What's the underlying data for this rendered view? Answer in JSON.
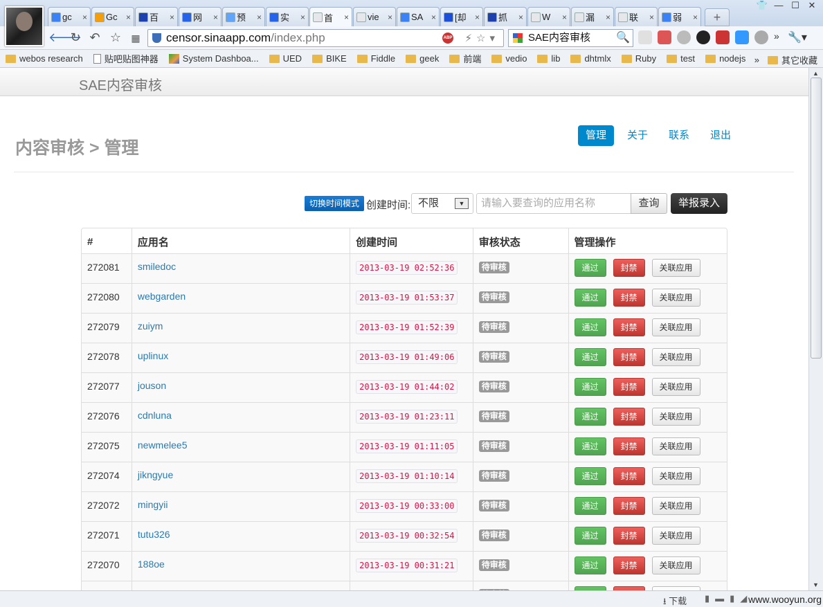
{
  "browser": {
    "tabs": [
      {
        "title": "gc",
        "fav": "#3b82f6",
        "active": false
      },
      {
        "title": "Gc",
        "fav": "#f59e0b",
        "active": false
      },
      {
        "title": "百",
        "fav": "#1e40af",
        "active": false
      },
      {
        "title": "网",
        "fav": "#2563eb",
        "active": false
      },
      {
        "title": "预",
        "fav": "#60a5fa",
        "active": false
      },
      {
        "title": "实",
        "fav": "#2563eb",
        "active": false
      },
      {
        "title": "首",
        "fav": "#e5e7eb",
        "active": true
      },
      {
        "title": "vie",
        "fav": "#e5e7eb",
        "active": false
      },
      {
        "title": "SA",
        "fav": "#3b82f6",
        "active": false
      },
      {
        "title": "[却",
        "fav": "#1d4ed8",
        "active": false
      },
      {
        "title": "抓",
        "fav": "#1e40af",
        "active": false
      },
      {
        "title": "W",
        "fav": "#e5e7eb",
        "active": false
      },
      {
        "title": "漏",
        "fav": "#e5e7eb",
        "active": false
      },
      {
        "title": "联",
        "fav": "#e5e7eb",
        "active": false
      },
      {
        "title": "弱",
        "fav": "#3b82f6",
        "active": false
      }
    ],
    "tab_close": "×",
    "new_tab": "+",
    "url_host": "censor.sinaapp.com",
    "url_path": "/index.php",
    "search_text": "SAE内容审核",
    "abp_label": "ABP",
    "bookmarks": [
      {
        "label": "webos research",
        "icon": "folder"
      },
      {
        "label": "贴吧贴图神器",
        "icon": "page"
      },
      {
        "label": "System Dashboa...",
        "icon": "dash"
      },
      {
        "label": "UED",
        "icon": "folder"
      },
      {
        "label": "BIKE",
        "icon": "folder"
      },
      {
        "label": "Fiddle",
        "icon": "folder"
      },
      {
        "label": "geek",
        "icon": "folder"
      },
      {
        "label": "前端",
        "icon": "folder"
      },
      {
        "label": "vedio",
        "icon": "folder"
      },
      {
        "label": "lib",
        "icon": "folder"
      },
      {
        "label": "dhtmlx",
        "icon": "folder"
      },
      {
        "label": "Ruby",
        "icon": "folder"
      },
      {
        "label": "test",
        "icon": "folder"
      },
      {
        "label": "nodejs",
        "icon": "folder"
      }
    ],
    "bookmarks_more": "»",
    "other_bookmarks": "其它收藏",
    "status_download": "下载",
    "watermark": "www.wooyun.org"
  },
  "page": {
    "brand": "SAE内容审核",
    "breadcrumb": "内容审核 > 管理",
    "nav": [
      {
        "label": "管理",
        "active": true
      },
      {
        "label": "关于",
        "active": false
      },
      {
        "label": "联系",
        "active": false
      },
      {
        "label": "退出",
        "active": false
      }
    ],
    "filter": {
      "mode_button": "切换时间模式",
      "created_label": "创建时间:",
      "select_value": "不限",
      "query_placeholder": "请输入要查询的应用名称",
      "query_button": "查询",
      "report_button": "举报录入"
    },
    "table": {
      "headers": [
        "#",
        "应用名",
        "创建时间",
        "审核状态",
        "管理操作"
      ],
      "actions": {
        "pass": "通过",
        "ban": "封禁",
        "related": "关联应用"
      },
      "status": "待审核",
      "rows": [
        {
          "id": "272081",
          "name": "smiledoc",
          "time": "2013-03-19 02:52:36"
        },
        {
          "id": "272080",
          "name": "webgarden",
          "time": "2013-03-19 01:53:37"
        },
        {
          "id": "272079",
          "name": "zuiym",
          "time": "2013-03-19 01:52:39"
        },
        {
          "id": "272078",
          "name": "uplinux",
          "time": "2013-03-19 01:49:06"
        },
        {
          "id": "272077",
          "name": "jouson",
          "time": "2013-03-19 01:44:02"
        },
        {
          "id": "272076",
          "name": "cdnluna",
          "time": "2013-03-19 01:23:11"
        },
        {
          "id": "272075",
          "name": "newmelee5",
          "time": "2013-03-19 01:11:05"
        },
        {
          "id": "272074",
          "name": "jikngyue",
          "time": "2013-03-19 01:10:14"
        },
        {
          "id": "272072",
          "name": "mingyii",
          "time": "2013-03-19 00:33:00"
        },
        {
          "id": "272071",
          "name": "tutu326",
          "time": "2013-03-19 00:32:54"
        },
        {
          "id": "272070",
          "name": "188oe",
          "time": "2013-03-19 00:31:21"
        },
        {
          "id": "",
          "name": "",
          "time": ""
        }
      ]
    }
  }
}
